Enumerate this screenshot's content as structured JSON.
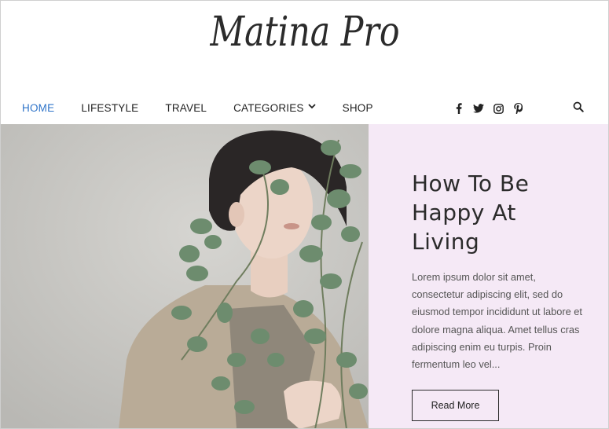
{
  "logo": {
    "text": "Matina Pro"
  },
  "nav": {
    "home": "HOME",
    "lifestyle": "LIFESTYLE",
    "travel": "TRAVEL",
    "categories": "CATEGORIES",
    "shop": "SHOP"
  },
  "social": {
    "icons": [
      "facebook-icon",
      "twitter-icon",
      "instagram-icon",
      "pinterest-icon"
    ]
  },
  "hero": {
    "title": "How To Be Happy At Living",
    "excerpt": "Lorem ipsum dolor sit amet, consectetur adipiscing elit, sed do eiusmod tempor incididunt ut labore et dolore magna aliqua. Amet tellus cras adipiscing enim eu turpis. Proin fermentum leo vel...",
    "button": "Read More"
  },
  "colors": {
    "accent": "#2f74c9",
    "panel_bg": "#f5e9f6",
    "text_dark": "#2b2b2b"
  }
}
